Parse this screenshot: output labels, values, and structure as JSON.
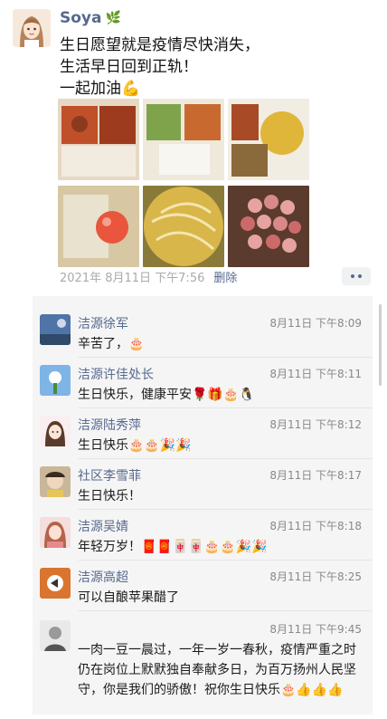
{
  "post": {
    "author": "Soya",
    "text_lines": [
      "生日愿望就是疫情尽快消失，",
      "生活早日回到正轨！",
      "一起加油💪"
    ],
    "time": "2021年 8月11日  下午7:56",
    "delete_label": "删除"
  },
  "photos": [
    {
      "name": "food-photo-1",
      "colors": [
        "#c0502a",
        "#e6d8c4",
        "#8b3a1f"
      ]
    },
    {
      "name": "food-photo-2",
      "colors": [
        "#7fa34a",
        "#efe9dc",
        "#c86a2f"
      ]
    },
    {
      "name": "food-photo-3",
      "colors": [
        "#e0b63a",
        "#f2ede3",
        "#a84a26"
      ]
    },
    {
      "name": "food-photo-4",
      "colors": [
        "#d7c7a3",
        "#e9553d",
        "#f0efe8"
      ]
    },
    {
      "name": "soup-photo",
      "colors": [
        "#d9b64a",
        "#f3e6b0",
        "#8a7a3a"
      ]
    },
    {
      "name": "apples-photo",
      "colors": [
        "#e6a3a0",
        "#cc6a6a",
        "#5a3b2e"
      ]
    }
  ],
  "comments": [
    {
      "name": "洁源徐军",
      "time": "8月11日  下午8:09",
      "text": "辛苦了，🎂"
    },
    {
      "name": "洁源许佳处长",
      "time": "8月11日  下午8:11",
      "text": "生日快乐，健康平安🌹🎁🎂🐧"
    },
    {
      "name": "洁源陆秀萍",
      "time": "8月11日  下午8:12",
      "text": "生日快乐🎂🎂🎉🎉"
    },
    {
      "name": "社区李雪菲",
      "time": "8月11日  下午8:17",
      "text": "生日快乐！"
    },
    {
      "name": "洁源吴婧",
      "time": "8月11日  下午8:18",
      "text": "年轻万岁！🧧🧧🀄🀄🎂🎂🎉🎉"
    },
    {
      "name": "洁源高超",
      "time": "8月11日  下午8:25",
      "text": "可以自酿苹果醋了"
    },
    {
      "name": "",
      "time": "8月11日  下午9:45",
      "text": "一肉一豆一晨过，一年一岁一春秋，疫情严重之时仍在岗位上默默独自奉献多日，为百万扬州人民坚守，你是我们的骄傲！祝你生日快乐🎂👍👍👍"
    }
  ],
  "colors": {
    "link": "#56698f",
    "comment_bg": "#f5f5f5"
  }
}
